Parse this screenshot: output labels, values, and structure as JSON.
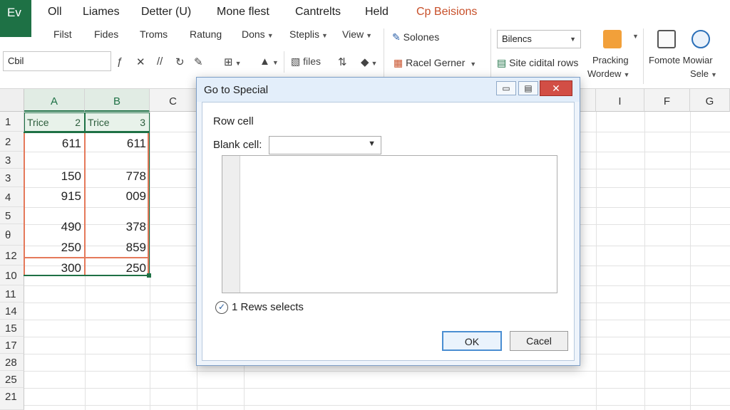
{
  "app": {
    "badge": "Ev"
  },
  "menu": {
    "tabs": [
      "Oll",
      "Liames",
      "Detter (U)",
      "Mone flest",
      "Cantrelts",
      "Held",
      "Cp Beisions"
    ]
  },
  "ribbon": {
    "row1": [
      "Filst",
      "Fides",
      "Troms",
      "Ratung",
      "Dons",
      "Steplis",
      "View"
    ],
    "name_box": "Cbil",
    "toolbar": {
      "files_label": "files"
    },
    "group_solones": "Solones",
    "group_racel": "Racel Gerner",
    "style_select": "Bilencs",
    "site_rows": "Site cidital rows",
    "pracking": "Pracking",
    "pracking_sub": "Wordew",
    "fomote": "Fomote Mowiar",
    "fomote_sub": "Sele"
  },
  "grid": {
    "columns": [
      "A",
      "B",
      "C",
      "I",
      "F",
      "G"
    ],
    "rows": [
      "1",
      "2",
      "3",
      "3",
      "4",
      "5",
      "θ",
      "12",
      "10",
      "11",
      "14",
      "15",
      "17",
      "28",
      "25",
      "21"
    ],
    "header_row": [
      {
        "label": "Trice",
        "num": "2"
      },
      {
        "label": "Trice",
        "num": "3"
      }
    ],
    "values": [
      {
        "a": "611",
        "b": "611"
      },
      {
        "a": "150",
        "b": "778"
      },
      {
        "a": "915",
        "b": "009"
      },
      {
        "a": "490",
        "b": "378"
      },
      {
        "a": "250",
        "b": "859"
      },
      {
        "a": "300",
        "b": "250"
      }
    ]
  },
  "dialog": {
    "title": "Go to Special",
    "row_cell_label": "Row cell",
    "blank_cell_label": "Blank cell:",
    "blank_cell_value": "",
    "checkbox_label": "1 Rews selects",
    "ok_label": "OK",
    "cancel_label": "Cacel"
  },
  "colors": {
    "brand": "#1e7145",
    "accent": "#c8502a",
    "selection_orange": "#e5795a",
    "close_red": "#d24e45"
  }
}
